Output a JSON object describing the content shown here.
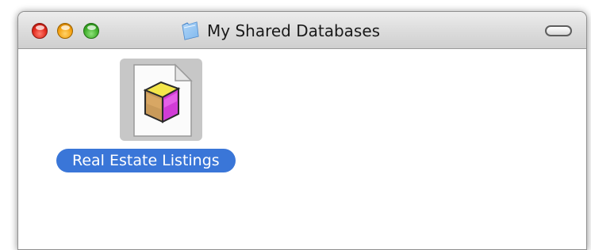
{
  "window": {
    "title": "My Shared Databases",
    "title_icon": "folder-icon"
  },
  "titlebar_buttons": {
    "close": "close-button",
    "minimize": "minimize-button",
    "zoom": "zoom-button",
    "toolbar_toggle": "toolbar-toggle-button"
  },
  "items": [
    {
      "label": "Real Estate Listings",
      "icon": "database-document-icon",
      "selected": true
    }
  ],
  "colors": {
    "selection": "#3a76d8",
    "icon_highlight": "#c7c7c7",
    "close": "#e0281b",
    "minimize": "#f5a10f",
    "zoom": "#3fae2a"
  }
}
